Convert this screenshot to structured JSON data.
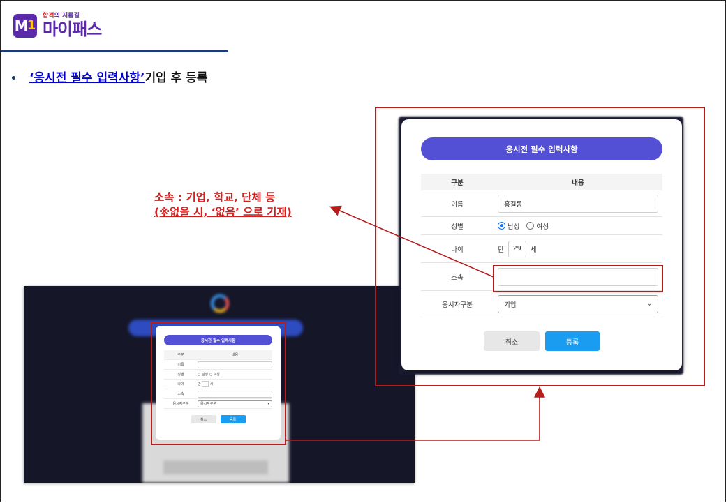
{
  "logo": {
    "tagline_highlight": "합격",
    "tagline_rest": "의 지름길",
    "name": "마이패스",
    "mark": "M",
    "mark_num": "1"
  },
  "bullet": {
    "marker": "•",
    "link_text": "‘응시전 필수 입력사항’",
    "rest": " 기입 후 등록"
  },
  "annotation": {
    "line1": "소속 : 기업, 학교, 단체 등",
    "line2": "(※없을 시, ‘없음’ 으로 기재)"
  },
  "modal": {
    "title": "응시전 필수 입력사항",
    "header": {
      "col1": "구분",
      "col2": "내용"
    },
    "name_label": "이름",
    "name_value": "홍길동",
    "gender_label": "성별",
    "gender_male": "남성",
    "gender_female": "여성",
    "age_label": "나이",
    "age_prefix": "만",
    "age_value": "29",
    "age_suffix": "세",
    "affiliation_label": "소속",
    "affiliation_value": "",
    "type_label": "응시자구분",
    "type_value": "기업",
    "cancel": "취소",
    "submit": "등록"
  },
  "mini_modal": {
    "title": "응시전 필수 입력사항",
    "header": {
      "col1": "구분",
      "col2": "내용"
    },
    "name_label": "이름",
    "gender_label": "성별",
    "gender_male": "남성",
    "gender_female": "여성",
    "age_label": "나이",
    "age_prefix": "만",
    "age_suffix": "세",
    "affiliation_label": "소속",
    "type_label": "응시자구분",
    "type_value": "응시자구분",
    "cancel": "취소",
    "submit": "등록"
  },
  "colors": {
    "accent": "#5450d6",
    "highlight": "#b61e1e",
    "submit": "#1a9cf0",
    "brand": "#5a2aa8"
  }
}
